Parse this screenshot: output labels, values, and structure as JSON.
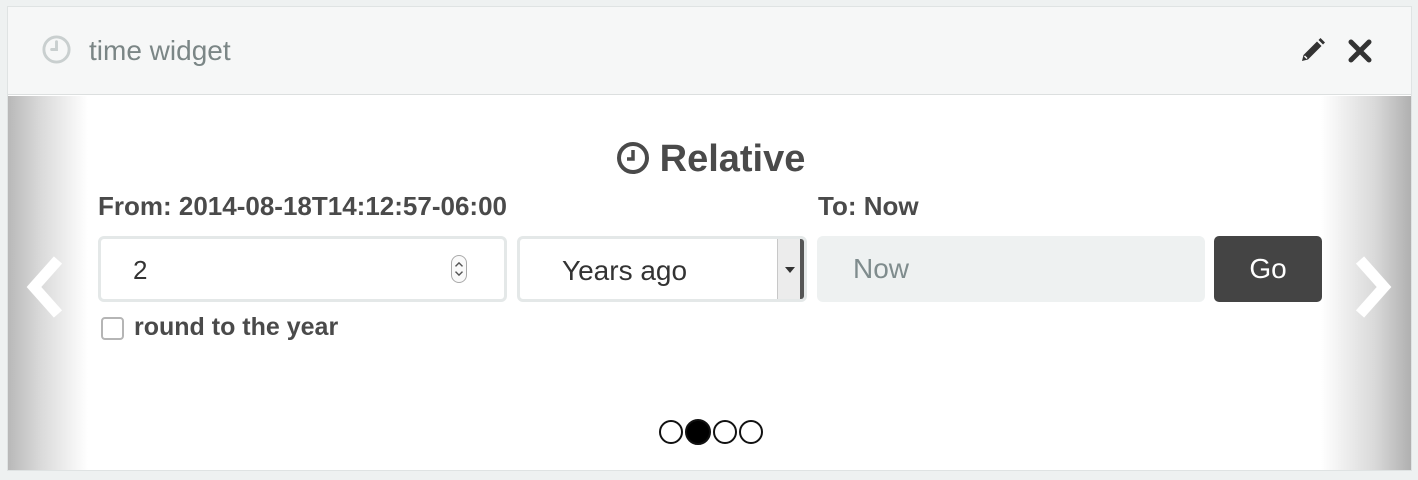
{
  "header": {
    "title": "time widget",
    "icons": [
      "clock-icon",
      "pencil-icon",
      "close-icon"
    ]
  },
  "carousel": {
    "heading": "Relative",
    "from_label": "From: 2014-08-18T14:12:57-06:00",
    "to_label": "To: Now",
    "amount_value": "2",
    "unit_selected": "Years ago",
    "to_placeholder": "Now",
    "go_label": "Go",
    "round_label": "round to the year",
    "round_checked": false,
    "slide_count": 4,
    "active_slide": 2
  },
  "colors": {
    "header_bg": "#f6f7f7",
    "title_text": "#7b8686",
    "go_button_bg": "#444444",
    "to_input_bg": "#eef1f1"
  }
}
